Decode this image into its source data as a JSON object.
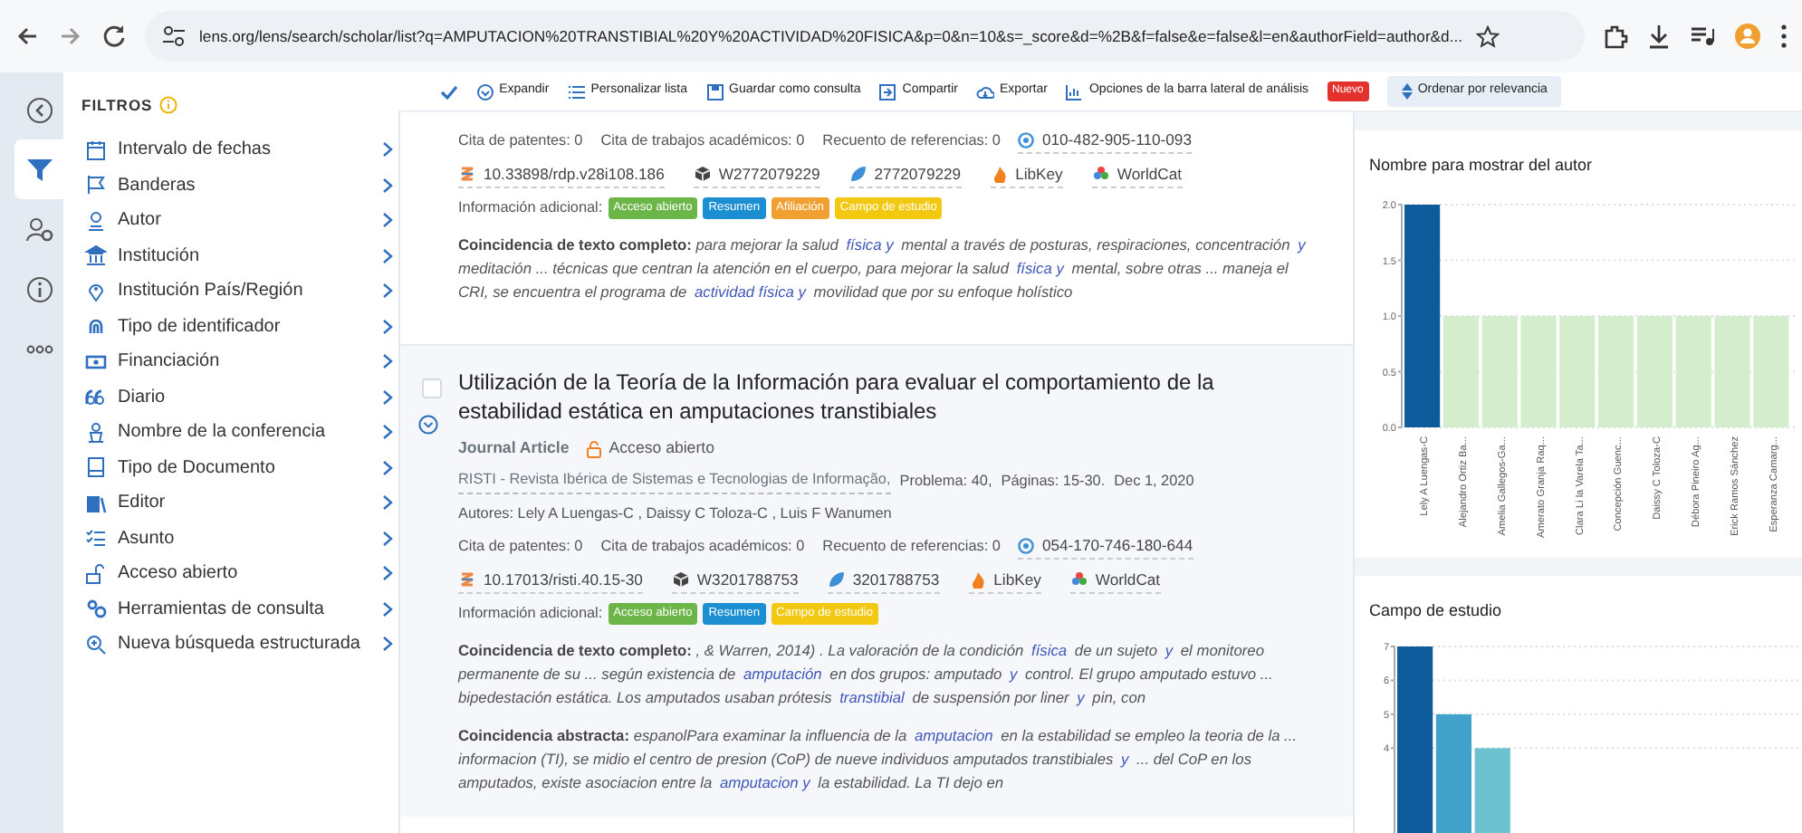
{
  "browser": {
    "url": "lens.org/lens/search/scholar/list?q=AMPUTACION%20TRANSTIBIAL%20Y%20ACTIVIDAD%20FISICA&p=0&n=10&s=_score&d=%2B&f=false&e=false&l=en&authorField=author&d..."
  },
  "rail": [
    {
      "kind": "collapse",
      "selected": false
    },
    {
      "kind": "filter",
      "selected": true
    },
    {
      "kind": "people",
      "selected": false
    },
    {
      "kind": "info",
      "selected": false
    },
    {
      "kind": "more",
      "selected": false
    }
  ],
  "filters": {
    "title": "FILTROS",
    "items": [
      {
        "label": "Intervalo de fechas"
      },
      {
        "label": "Banderas"
      },
      {
        "label": "Autor"
      },
      {
        "label": "Institución"
      },
      {
        "label": "Institución País/Región"
      },
      {
        "label": "Tipo de identificador"
      },
      {
        "label": "Financiación"
      },
      {
        "label": "Diario"
      },
      {
        "label": "Nombre de la conferencia"
      },
      {
        "label": "Tipo de Documento"
      },
      {
        "label": "Editor"
      },
      {
        "label": "Asunto"
      },
      {
        "label": "Acceso abierto"
      },
      {
        "label": "Herramientas de consulta"
      },
      {
        "label": "Nueva búsqueda estructurada"
      }
    ]
  },
  "toolbar": {
    "items": [
      {
        "kind": "expand",
        "label": "Expandir"
      },
      {
        "kind": "list",
        "label": "Personalizar lista"
      },
      {
        "kind": "save",
        "label": "Guardar como consulta"
      },
      {
        "kind": "share",
        "label": "Compartir"
      },
      {
        "kind": "export",
        "label": "Exportar"
      },
      {
        "kind": "chart",
        "label": "Opciones de la barra lateral de análisis",
        "badge": "Nuevo"
      }
    ],
    "sort": "Ordenar por relevancia"
  },
  "results": [
    {
      "counts": [
        "Cita de patentes: 0",
        "Cita de trabajos académicos: 0",
        "Recuento de referencias: 0"
      ],
      "lens_id": "010-482-905-110-093",
      "links": [
        {
          "kind": "doi",
          "text": "10.33898/rdp.v28i108.186"
        },
        {
          "kind": "openalex",
          "text": "W2772079229"
        },
        {
          "kind": "mag",
          "text": "2772079229"
        },
        {
          "kind": "libkey",
          "text": "LibKey"
        },
        {
          "kind": "worldcat",
          "text": "WorldCat"
        }
      ],
      "info_label": "Información adicional:",
      "tags": [
        {
          "text": "Acceso abierto",
          "color": "#6cb548"
        },
        {
          "text": "Resumen",
          "color": "#1b8fd1"
        },
        {
          "text": "Afiliación",
          "color": "#f0a030"
        },
        {
          "text": "Campo de estudio",
          "color": "#f2c811"
        }
      ],
      "snippets": [
        {
          "label": "Coincidencia de texto completo:",
          "parts": [
            {
              "t": "para mejorar la salud ",
              "m": false
            },
            {
              "t": "física y",
              "m": true
            },
            {
              "t": " mental a través de posturas, respiraciones, concentración ",
              "m": false
            },
            {
              "t": "y",
              "m": true
            },
            {
              "t": " meditación ... técnicas que centran la atención en el cuerpo, para mejorar la salud ",
              "m": false
            },
            {
              "t": "física y",
              "m": true
            },
            {
              "t": " mental, sobre otras ... maneja el CRI, se encuentra el programa de ",
              "m": false
            },
            {
              "t": "actividad física y",
              "m": true
            },
            {
              "t": " movilidad que por su enfoque holístico",
              "m": false
            }
          ]
        }
      ]
    },
    {
      "selected": false,
      "title": "Utilización de la Teoría de la Información para evaluar el comportamiento de la estabilidad estática en amputaciones transtibiales",
      "type": "Journal Article",
      "access": "Acceso abierto",
      "source": "RISTI - Revista Ibérica de Sistemas e Tecnologias de Informação,",
      "details": [
        "Problema: 40,",
        "Páginas: 15-30.",
        "Dec 1, 2020"
      ],
      "authors": "Autores: Lely A Luengas-C , Daissy C Toloza-C , Luis F Wanumen",
      "counts": [
        "Cita de patentes: 0",
        "Cita de trabajos académicos: 0",
        "Recuento de referencias: 0"
      ],
      "lens_id": "054-170-746-180-644",
      "links": [
        {
          "kind": "doi",
          "text": "10.17013/risti.40.15-30"
        },
        {
          "kind": "openalex",
          "text": "W3201788753"
        },
        {
          "kind": "mag",
          "text": "3201788753"
        },
        {
          "kind": "libkey",
          "text": "LibKey"
        },
        {
          "kind": "worldcat",
          "text": "WorldCat"
        }
      ],
      "info_label": "Información adicional:",
      "tags": [
        {
          "text": "Acceso abierto",
          "color": "#6cb548"
        },
        {
          "text": "Resumen",
          "color": "#1b8fd1"
        },
        {
          "text": "Campo de estudio",
          "color": "#f2c811"
        }
      ],
      "snippets": [
        {
          "label": "Coincidencia de texto completo:",
          "parts": [
            {
              "t": ", & Warren, 2014) . La valoración de la condición ",
              "m": false
            },
            {
              "t": "física",
              "m": true
            },
            {
              "t": " de un sujeto ",
              "m": false
            },
            {
              "t": "y",
              "m": true
            },
            {
              "t": " el monitoreo permanente de su ... según existencia de ",
              "m": false
            },
            {
              "t": "amputación",
              "m": true
            },
            {
              "t": " en dos grupos: amputado ",
              "m": false
            },
            {
              "t": "y",
              "m": true
            },
            {
              "t": " control. El grupo amputado estuvo ... bipedestación estática. Los amputados usaban prótesis ",
              "m": false
            },
            {
              "t": "transtibial",
              "m": true
            },
            {
              "t": " de suspensión por liner ",
              "m": false
            },
            {
              "t": "y",
              "m": true
            },
            {
              "t": " pin, con",
              "m": false
            }
          ]
        },
        {
          "label": "Coincidencia abstracta:",
          "parts": [
            {
              "t": "espanolPara examinar la influencia de la ",
              "m": false
            },
            {
              "t": "amputacion",
              "m": true
            },
            {
              "t": " en la estabilidad se empleo la teoria de la ... informacion (TI), se midio el centro de presion (CoP) de nueve individuos amputados transtibiales ",
              "m": false
            },
            {
              "t": "y",
              "m": true
            },
            {
              "t": " ... del CoP en los amputados, existe asociacion entre la ",
              "m": false
            },
            {
              "t": "amputacion y",
              "m": true
            },
            {
              "t": " la estabilidad. La TI dejo en",
              "m": false
            }
          ]
        }
      ]
    }
  ],
  "analysis": [
    {
      "title": "Nombre para mostrar del autor",
      "chart_data": {
        "type": "bar",
        "categories": [
          "Lely A Luengas-C",
          "Alejandro Ortiz Ba...",
          "Amelia Gallegos-Ga...",
          "Amerato Granja Raq...",
          "Clara Li la Varela Ta...",
          "Concepción Guenc...",
          "Daissy C Toloza-C",
          "Débora Pineiro Ag...",
          "Erick Ramos Sánchez",
          "Esperanza Camarg..."
        ],
        "values": [
          2,
          1,
          1,
          1,
          1,
          1,
          1,
          1,
          1,
          1
        ],
        "colors": [
          "#0e5c9c",
          "#d4eecd",
          "#d4eecd",
          "#d4eecd",
          "#d4eecd",
          "#d4eecd",
          "#d4eecd",
          "#d4eecd",
          "#d4eecd",
          "#d4eecd"
        ],
        "grid": true,
        "ylim": [
          0,
          2
        ],
        "yticks": [
          {
            "value": 0,
            "label": "0.0"
          },
          {
            "value": 0.5,
            "label": "0.5"
          },
          {
            "value": 1,
            "label": "1.0"
          },
          {
            "value": 1.5,
            "label": "1.5"
          },
          {
            "value": 2,
            "label": "2.0"
          }
        ]
      }
    },
    {
      "title": "Campo de estudio",
      "chart_data": {
        "type": "bar",
        "values": [
          7,
          5,
          4
        ],
        "colors": [
          "#0e5c9c",
          "#41a2cc",
          "#6cc3cf"
        ],
        "grid": true,
        "ylim": [
          0,
          7
        ],
        "yticks": [
          4,
          5,
          6,
          7
        ]
      }
    }
  ]
}
